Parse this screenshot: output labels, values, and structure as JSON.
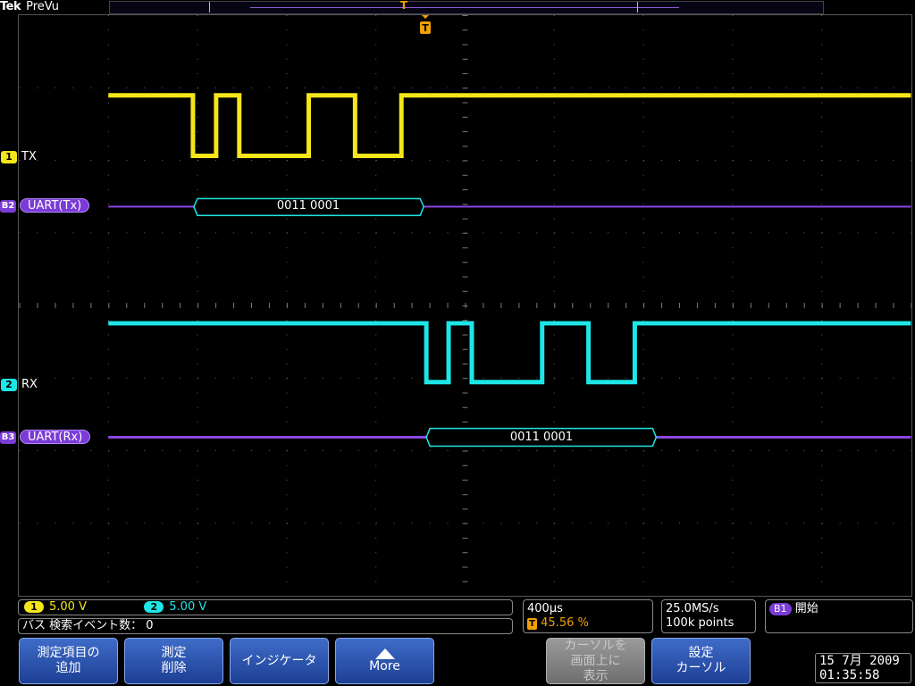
{
  "header": {
    "brand": "Tek",
    "mode": "PreVu",
    "trigger_position_marker": "T"
  },
  "channels": [
    {
      "id": "1",
      "label": "TX",
      "color": "#f5e61a"
    },
    {
      "id": "2",
      "label": "RX",
      "color": "#1ee6e6"
    }
  ],
  "buses": [
    {
      "id": "B2",
      "label": "UART(Tx)",
      "decoded": "0011 0001",
      "color": "#8c46e6"
    },
    {
      "id": "B3",
      "label": "UART(Rx)",
      "decoded": "0011 0001",
      "color": "#8c46e6"
    }
  ],
  "status": {
    "ch1_scale": "5.00 V",
    "ch2_scale": "5.00 V",
    "event_count_label": "バス 検索イベント数：",
    "event_count_value": "0",
    "time_per_div": "400µs",
    "trigger_position": "45.56 %",
    "sample_rate": "25.0MS/s",
    "record_length": "100k points",
    "bus_trigger_chip": "B1",
    "bus_trigger_state": "開始"
  },
  "menu": {
    "btn1_line1": "測定項目の",
    "btn1_line2": "追加",
    "btn2_line1": "測定",
    "btn2_line2": "削除",
    "btn3": "インジケータ",
    "btn4_icon": "up-triangle-icon",
    "btn4": "More",
    "btn5_line1": "カーソルを",
    "btn5_line2": "画面上に",
    "btn5_line3": "表示",
    "btn6_line1": "設定",
    "btn6_line2": "カーソル"
  },
  "datetime": {
    "date": "15 7月  2009",
    "time": "01:35:58"
  }
}
